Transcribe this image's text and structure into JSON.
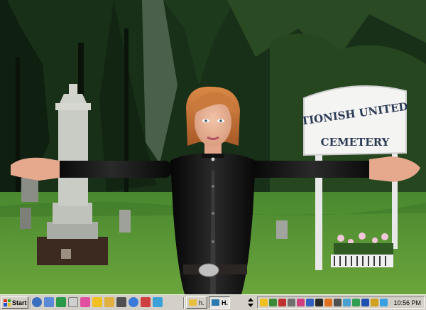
{
  "desktop": {
    "sign_line1": "TIONISH UNITED",
    "sign_line2": "CEMETERY"
  },
  "taskbar": {
    "start_label": "Start",
    "tasks": [
      {
        "label": "h.",
        "icon": "folder-icon",
        "active": false
      },
      {
        "label": "H.",
        "icon": "app-window-icon",
        "active": true
      }
    ],
    "clock": "10:56 PM"
  },
  "colors": {
    "taskbar_bg": "#d4d0c8",
    "sky": "#c9d7cf",
    "grass": "#4f8f2f",
    "outfit": "#121212",
    "hair": "#c9743a"
  }
}
